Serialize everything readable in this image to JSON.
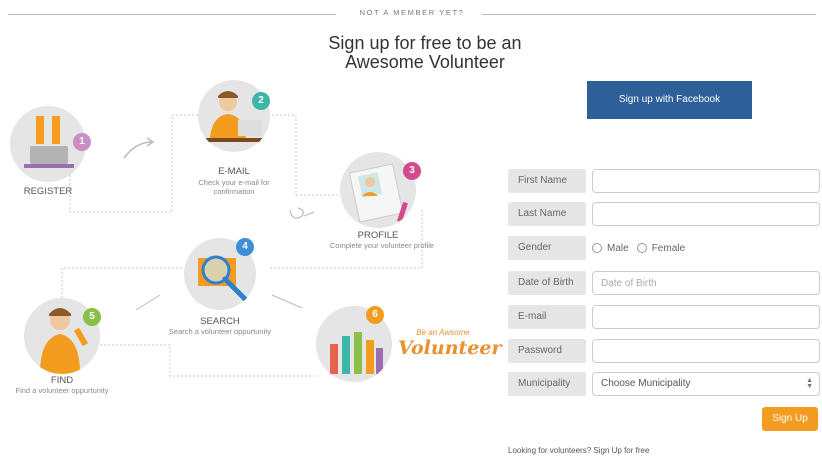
{
  "header": {
    "divider_text": "NOT A MEMBER YET?",
    "headline_line1": "Sign up for free to be an",
    "headline_line2": "Awesome Volunteer"
  },
  "steps": [
    {
      "number": "1",
      "title": "REGISTER",
      "desc": "",
      "badge_color": "#c78fc4"
    },
    {
      "number": "2",
      "title": "E-MAIL",
      "desc_line1": "Check your e-mail for",
      "desc_line2": "confirmation",
      "badge_color": "#3bb6a8"
    },
    {
      "number": "3",
      "title": "PROFILE",
      "desc_line1": "Complete your volunteer profile",
      "badge_color": "#d24b8f"
    },
    {
      "number": "4",
      "title": "SEARCH",
      "desc_line1": "Search a volunteer oppurtunity",
      "badge_color": "#3f8fd8"
    },
    {
      "number": "5",
      "title": "FIND",
      "desc_line1": "Find a volunteer oppurtunity",
      "badge_color": "#8ac04a"
    },
    {
      "number": "6",
      "title": "",
      "badge_color": "#f39c1f"
    }
  ],
  "awesome": {
    "small": "Be an Awsome",
    "large": "Volunteer"
  },
  "facebook_button": "Sign up with Facebook",
  "form": {
    "first_name_label": "First Name",
    "last_name_label": "Last Name",
    "gender_label": "Gender",
    "gender_male": "Male",
    "gender_female": "Female",
    "dob_label": "Date of Birth",
    "dob_placeholder": "Date of Birth",
    "email_label": "E-mail",
    "password_label": "Password",
    "municipality_label": "Municipality",
    "municipality_value": "Choose Municipality",
    "signup_button": "Sign Up"
  },
  "footer": {
    "link_text": "Looking for volunteers? Sign Up for free"
  },
  "colors": {
    "facebook": "#2d5f99",
    "signup": "#f39c1f",
    "accent_orange": "#e8912f"
  }
}
